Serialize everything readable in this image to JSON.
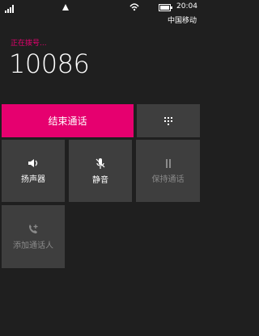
{
  "status_bar": {
    "time": "20:04",
    "carrier": "中国移动"
  },
  "call": {
    "status": "正在拨号...",
    "number": "10086"
  },
  "actions": {
    "end_call": "结束通话",
    "speaker": "扬声器",
    "mute": "静音",
    "hold": "保持通话",
    "add_call": "添加通话人"
  },
  "colors": {
    "accent": "#e6006f",
    "background": "#1f1f1f",
    "tile": "#3e3e3e"
  }
}
